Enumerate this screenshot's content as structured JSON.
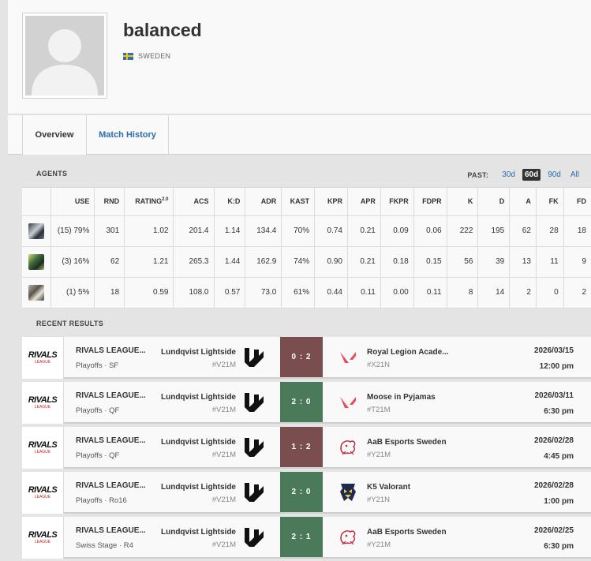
{
  "player": {
    "name": "balanced",
    "country": "SWEDEN"
  },
  "tabs": [
    {
      "label": "Overview",
      "active": true
    },
    {
      "label": "Match History",
      "active": false
    }
  ],
  "agents_section": {
    "title": "AGENTS",
    "past_label": "PAST:",
    "past_options": [
      "30d",
      "60d",
      "90d",
      "All"
    ],
    "past_selected": "60d",
    "headers": [
      "",
      "USE",
      "RND",
      "RATING",
      "ACS",
      "K:D",
      "ADR",
      "KAST",
      "KPR",
      "APR",
      "FKPR",
      "FDPR",
      "K",
      "D",
      "A",
      "FK",
      "FD"
    ],
    "rating_sup": "2.0",
    "rows": [
      {
        "agent": "agent-1",
        "use": "(15) 79%",
        "rnd": "301",
        "rating": "1.02",
        "acs": "201.4",
        "kd": "1.14",
        "adr": "134.4",
        "kast": "70%",
        "kpr": "0.74",
        "apr": "0.21",
        "fkpr": "0.09",
        "fdpr": "0.06",
        "k": "222",
        "d": "195",
        "a": "62",
        "fk": "28",
        "fd": "18"
      },
      {
        "agent": "agent-2",
        "use": "(3) 16%",
        "rnd": "62",
        "rating": "1.21",
        "acs": "265.3",
        "kd": "1.44",
        "adr": "162.9",
        "kast": "74%",
        "kpr": "0.90",
        "apr": "0.21",
        "fkpr": "0.18",
        "fdpr": "0.15",
        "k": "56",
        "d": "39",
        "a": "13",
        "fk": "11",
        "fd": "9"
      },
      {
        "agent": "agent-3",
        "use": "(1) 5%",
        "rnd": "18",
        "rating": "0.59",
        "acs": "108.0",
        "kd": "0.57",
        "adr": "73.0",
        "kast": "61%",
        "kpr": "0.44",
        "apr": "0.11",
        "fkpr": "0.00",
        "fdpr": "0.11",
        "k": "8",
        "d": "14",
        "a": "2",
        "fk": "0",
        "fd": "2"
      }
    ]
  },
  "results_section": {
    "title": "RECENT RESULTS",
    "league_logo_text": "RIVALS",
    "league_logo_sub": "LEAGUE",
    "matches": [
      {
        "event": "RIVALS LEAGUE...",
        "stage": "Playoffs · SF",
        "team1": "Lundqvist Lightside",
        "team1_tag": "#V21M",
        "score": "0 : 2",
        "result": "loss",
        "team2": "Royal Legion Acade...",
        "team2_tag": "#X21N",
        "team2_logo": "valorant",
        "date": "2026/03/15",
        "time": "12:00 pm"
      },
      {
        "event": "RIVALS LEAGUE...",
        "stage": "Playoffs · QF",
        "team1": "Lundqvist Lightside",
        "team1_tag": "#V21M",
        "score": "2 : 0",
        "result": "win",
        "team2": "Moose in Pyjamas",
        "team2_tag": "#T21M",
        "team2_logo": "valorant",
        "date": "2026/03/11",
        "time": "6:30 pm"
      },
      {
        "event": "RIVALS LEAGUE...",
        "stage": "Playoffs · QF",
        "team1": "Lundqvist Lightside",
        "team1_tag": "#V21M",
        "score": "1 : 2",
        "result": "loss",
        "team2": "AaB Esports Sweden",
        "team2_tag": "#Y21M",
        "team2_logo": "aab",
        "date": "2026/02/28",
        "time": "4:45 pm"
      },
      {
        "event": "RIVALS LEAGUE...",
        "stage": "Playoffs · Ro16",
        "team1": "Lundqvist Lightside",
        "team1_tag": "#V21M",
        "score": "2 : 0",
        "result": "win",
        "team2": "K5 Valorant",
        "team2_tag": "#Y21N",
        "team2_logo": "k5",
        "date": "2026/02/28",
        "time": "1:00 pm"
      },
      {
        "event": "RIVALS LEAGUE...",
        "stage": "Swiss Stage · R4",
        "team1": "Lundqvist Lightside",
        "team1_tag": "#V21M",
        "score": "2 : 1",
        "result": "win",
        "team2": "AaB Esports Sweden",
        "team2_tag": "#Y21M",
        "team2_logo": "aab",
        "date": "2026/02/25",
        "time": "6:30 pm"
      }
    ]
  },
  "colors": {
    "link": "#2a6db0",
    "win": "#4a7a5a",
    "loss": "#7a4e4e"
  }
}
